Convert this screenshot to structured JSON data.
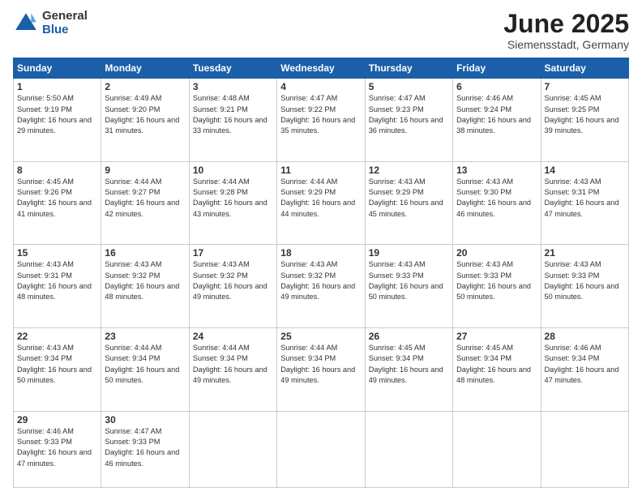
{
  "logo": {
    "general": "General",
    "blue": "Blue"
  },
  "title": "June 2025",
  "subtitle": "Siemensstadt, Germany",
  "weekdays": [
    "Sunday",
    "Monday",
    "Tuesday",
    "Wednesday",
    "Thursday",
    "Friday",
    "Saturday"
  ],
  "weeks": [
    [
      {
        "day": "1",
        "sunrise": "5:50 AM",
        "sunset": "9:19 PM",
        "daylight": "16 hours and 29 minutes."
      },
      {
        "day": "2",
        "sunrise": "4:49 AM",
        "sunset": "9:20 PM",
        "daylight": "16 hours and 31 minutes."
      },
      {
        "day": "3",
        "sunrise": "4:48 AM",
        "sunset": "9:21 PM",
        "daylight": "16 hours and 33 minutes."
      },
      {
        "day": "4",
        "sunrise": "4:47 AM",
        "sunset": "9:22 PM",
        "daylight": "16 hours and 35 minutes."
      },
      {
        "day": "5",
        "sunrise": "4:47 AM",
        "sunset": "9:23 PM",
        "daylight": "16 hours and 36 minutes."
      },
      {
        "day": "6",
        "sunrise": "4:46 AM",
        "sunset": "9:24 PM",
        "daylight": "16 hours and 38 minutes."
      },
      {
        "day": "7",
        "sunrise": "4:45 AM",
        "sunset": "9:25 PM",
        "daylight": "16 hours and 39 minutes."
      }
    ],
    [
      {
        "day": "8",
        "sunrise": "4:45 AM",
        "sunset": "9:26 PM",
        "daylight": "16 hours and 41 minutes."
      },
      {
        "day": "9",
        "sunrise": "4:44 AM",
        "sunset": "9:27 PM",
        "daylight": "16 hours and 42 minutes."
      },
      {
        "day": "10",
        "sunrise": "4:44 AM",
        "sunset": "9:28 PM",
        "daylight": "16 hours and 43 minutes."
      },
      {
        "day": "11",
        "sunrise": "4:44 AM",
        "sunset": "9:29 PM",
        "daylight": "16 hours and 44 minutes."
      },
      {
        "day": "12",
        "sunrise": "4:43 AM",
        "sunset": "9:29 PM",
        "daylight": "16 hours and 45 minutes."
      },
      {
        "day": "13",
        "sunrise": "4:43 AM",
        "sunset": "9:30 PM",
        "daylight": "16 hours and 46 minutes."
      },
      {
        "day": "14",
        "sunrise": "4:43 AM",
        "sunset": "9:31 PM",
        "daylight": "16 hours and 47 minutes."
      }
    ],
    [
      {
        "day": "15",
        "sunrise": "4:43 AM",
        "sunset": "9:31 PM",
        "daylight": "16 hours and 48 minutes."
      },
      {
        "day": "16",
        "sunrise": "4:43 AM",
        "sunset": "9:32 PM",
        "daylight": "16 hours and 48 minutes."
      },
      {
        "day": "17",
        "sunrise": "4:43 AM",
        "sunset": "9:32 PM",
        "daylight": "16 hours and 49 minutes."
      },
      {
        "day": "18",
        "sunrise": "4:43 AM",
        "sunset": "9:32 PM",
        "daylight": "16 hours and 49 minutes."
      },
      {
        "day": "19",
        "sunrise": "4:43 AM",
        "sunset": "9:33 PM",
        "daylight": "16 hours and 50 minutes."
      },
      {
        "day": "20",
        "sunrise": "4:43 AM",
        "sunset": "9:33 PM",
        "daylight": "16 hours and 50 minutes."
      },
      {
        "day": "21",
        "sunrise": "4:43 AM",
        "sunset": "9:33 PM",
        "daylight": "16 hours and 50 minutes."
      }
    ],
    [
      {
        "day": "22",
        "sunrise": "4:43 AM",
        "sunset": "9:34 PM",
        "daylight": "16 hours and 50 minutes."
      },
      {
        "day": "23",
        "sunrise": "4:44 AM",
        "sunset": "9:34 PM",
        "daylight": "16 hours and 50 minutes."
      },
      {
        "day": "24",
        "sunrise": "4:44 AM",
        "sunset": "9:34 PM",
        "daylight": "16 hours and 49 minutes."
      },
      {
        "day": "25",
        "sunrise": "4:44 AM",
        "sunset": "9:34 PM",
        "daylight": "16 hours and 49 minutes."
      },
      {
        "day": "26",
        "sunrise": "4:45 AM",
        "sunset": "9:34 PM",
        "daylight": "16 hours and 49 minutes."
      },
      {
        "day": "27",
        "sunrise": "4:45 AM",
        "sunset": "9:34 PM",
        "daylight": "16 hours and 48 minutes."
      },
      {
        "day": "28",
        "sunrise": "4:46 AM",
        "sunset": "9:34 PM",
        "daylight": "16 hours and 47 minutes."
      }
    ],
    [
      {
        "day": "29",
        "sunrise": "4:46 AM",
        "sunset": "9:33 PM",
        "daylight": "16 hours and 47 minutes."
      },
      {
        "day": "30",
        "sunrise": "4:47 AM",
        "sunset": "9:33 PM",
        "daylight": "16 hours and 46 minutes."
      },
      null,
      null,
      null,
      null,
      null
    ]
  ]
}
